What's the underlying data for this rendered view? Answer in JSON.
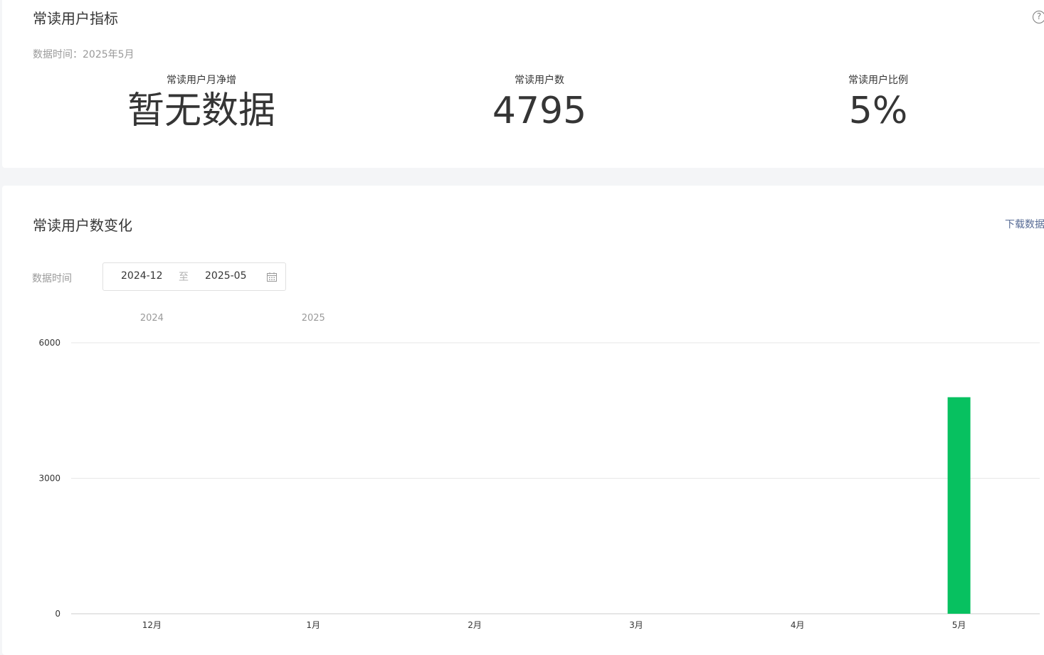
{
  "metrics_card": {
    "title": "常读用户指标",
    "help_icon_glyph": "?",
    "data_time": "数据时间：2025年5月",
    "metrics": [
      {
        "label": "常读用户月净增",
        "value": "暂无数据"
      },
      {
        "label": "常读用户数",
        "value": "4795"
      },
      {
        "label": "常读用户比例",
        "value": "5%"
      }
    ]
  },
  "chart_card": {
    "title": "常读用户数变化",
    "download_label": "下载数据",
    "filter_label": "数据时间",
    "date_start": "2024-12",
    "date_separator": "至",
    "date_end": "2025-05"
  },
  "chart_data": {
    "type": "bar",
    "year_labels": [
      {
        "label": "2024",
        "category": "12月"
      },
      {
        "label": "2025",
        "category": "1月"
      }
    ],
    "categories": [
      "12月",
      "1月",
      "2月",
      "3月",
      "4月",
      "5月"
    ],
    "values": [
      0,
      0,
      0,
      0,
      0,
      4795
    ],
    "yticks": [
      0,
      3000,
      6000
    ],
    "ylim": [
      0,
      6000
    ],
    "grid": true,
    "bar_color": "#07c160"
  }
}
